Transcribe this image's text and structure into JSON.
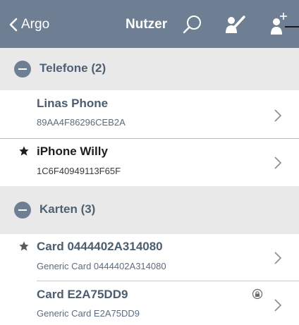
{
  "topbar": {
    "back_label": "Argo",
    "title": "Nutzer",
    "icons": [
      "back-chevron-icon",
      "search-icon",
      "user-key-icon",
      "add-user-icon"
    ],
    "color": "#6f7f93"
  },
  "sections": [
    {
      "title": "Telefone (2)",
      "rows": [
        {
          "title": "Linas Phone",
          "subtitle": "89AA4F86296CEB2A",
          "starred": false
        },
        {
          "title": "iPhone Willy",
          "subtitle": "1C6F40949113F65F",
          "starred": true
        }
      ]
    },
    {
      "title": "Karten (3)",
      "rows": [
        {
          "title": "Card 0444402A314080",
          "subtitle": "Generic Card 0444402A314080",
          "starred": true
        },
        {
          "title": "Card E2A75DD9",
          "subtitle": "Generic Card E2A75DD9",
          "starred": false,
          "status_icon": "lock-icon"
        }
      ]
    }
  ],
  "colors": {
    "accent": "#6f7f93",
    "section_background": "#e9e9e9",
    "title_text": "#4d5d70"
  }
}
